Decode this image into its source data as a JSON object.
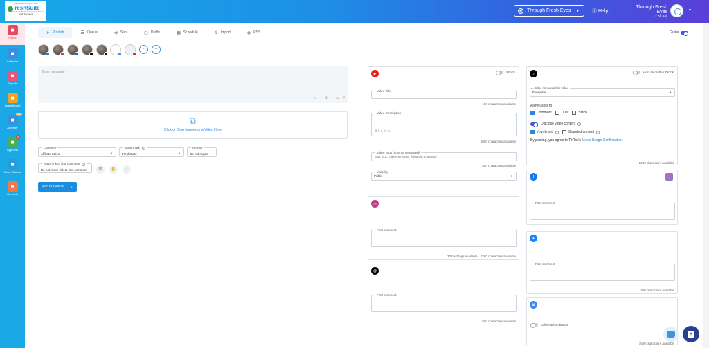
{
  "logo": {
    "top_line": "THROUGH FRESH EYES",
    "brand": "FreshSuite",
    "tagline": "All-In-One Social Media Management Tool for Small Businesses"
  },
  "header": {
    "account_selector": "Through Fresh Eyes",
    "help": "Help",
    "user_name": "Through Fresh Eyes",
    "time": "11:38 AM"
  },
  "sidebar": {
    "items": [
      {
        "label": "Publish",
        "icon": "paper-plane-icon",
        "color": "#e84a5f"
      },
      {
        "label": "Calendar",
        "icon": "calendar-icon",
        "color": "#3b8fe0"
      },
      {
        "label": "Reports",
        "icon": "chart-icon",
        "color": "#e8557a"
      },
      {
        "label": "Leaderboard",
        "icon": "trophy-icon",
        "color": "#f2a31b"
      },
      {
        "label": "AI Writer",
        "icon": "ai-icon",
        "color": "#3b8fe0",
        "badge": "NEW"
      },
      {
        "label": "Approval",
        "icon": "approval-icon",
        "color": "#4caf50",
        "badge": "22"
      },
      {
        "label": "Share Buttons",
        "icon": "share-icon",
        "color": "#2b9bd6"
      },
      {
        "label": "Contacts",
        "icon": "contacts-icon",
        "color": "#f0784a"
      }
    ]
  },
  "tabs": [
    {
      "label": "Publish",
      "icon": "send-icon"
    },
    {
      "label": "Queue",
      "icon": "queue-icon"
    },
    {
      "label": "Sent",
      "icon": "sent-icon"
    },
    {
      "label": "Drafts",
      "icon": "drafts-icon"
    },
    {
      "label": "Schedule",
      "icon": "schedule-icon"
    },
    {
      "label": "Import",
      "icon": "import-icon"
    },
    {
      "label": "RSS",
      "icon": "rss-icon"
    }
  ],
  "guide": "Guide",
  "compose": {
    "placeholder": "Enter message",
    "toolbar": [
      "▭",
      "◔",
      "B",
      "I",
      "☺",
      "#"
    ]
  },
  "drop": {
    "text": "Click or Drop Images or a Video Here"
  },
  "fields": {
    "category": {
      "label": "Category",
      "value": "Affiliate Sales"
    },
    "watermark": {
      "label": "Watermark",
      "value": "FreshSuite"
    },
    "repost": {
      "label": "Repost",
      "value": "Do not repost"
    },
    "move_link": {
      "label": "Move link to first comment",
      "value": "Do not move link to first comment"
    }
  },
  "add_to_queue": "Add to Queue",
  "youtube": {
    "shorts": "Shorts",
    "video_title_label": "Video Title",
    "title_avail": "100 characters available",
    "description_label": "Video Description",
    "desc_avail": "5000 characters available",
    "tags_label": "Video Tags (comma separated)",
    "tags_placeholder": "Tags (e.g., albert einstein, flying pig, mashup)",
    "tags_avail": "500 characters available",
    "visibility_label": "Visibility",
    "visibility_value": "Public"
  },
  "instagram": {
    "first_comment": "First comment",
    "hashtags_avail": "30 hashtags available",
    "chars_avail": "2200 characters available"
  },
  "threads": {
    "first_comment": "First comment",
    "chars_avail": "500 characters available"
  },
  "tiktok": {
    "hold_draft": "Hold as draft in TikTok",
    "who_label": "Who can view this video",
    "who_value": "Everyone",
    "allow_users": "Allow users to",
    "comment": "Comment",
    "duet": "Duet",
    "stitch": "Stitch",
    "disclose": "Disclose video content",
    "your_brand": "Your brand",
    "branded": "Branded content",
    "agree_prefix": "By posting, you agree to TikTok's",
    "agree_link": "Music Usage Confirmation.",
    "chars_avail": "2200 characters available"
  },
  "facebook": {
    "first_comment": "First comment"
  },
  "bluesky": {
    "first_comment": "First comment",
    "chars_avail": "300 characters available"
  },
  "gbp": {
    "cta": "call-to-action button",
    "chars_avail": "1500 characters available"
  }
}
